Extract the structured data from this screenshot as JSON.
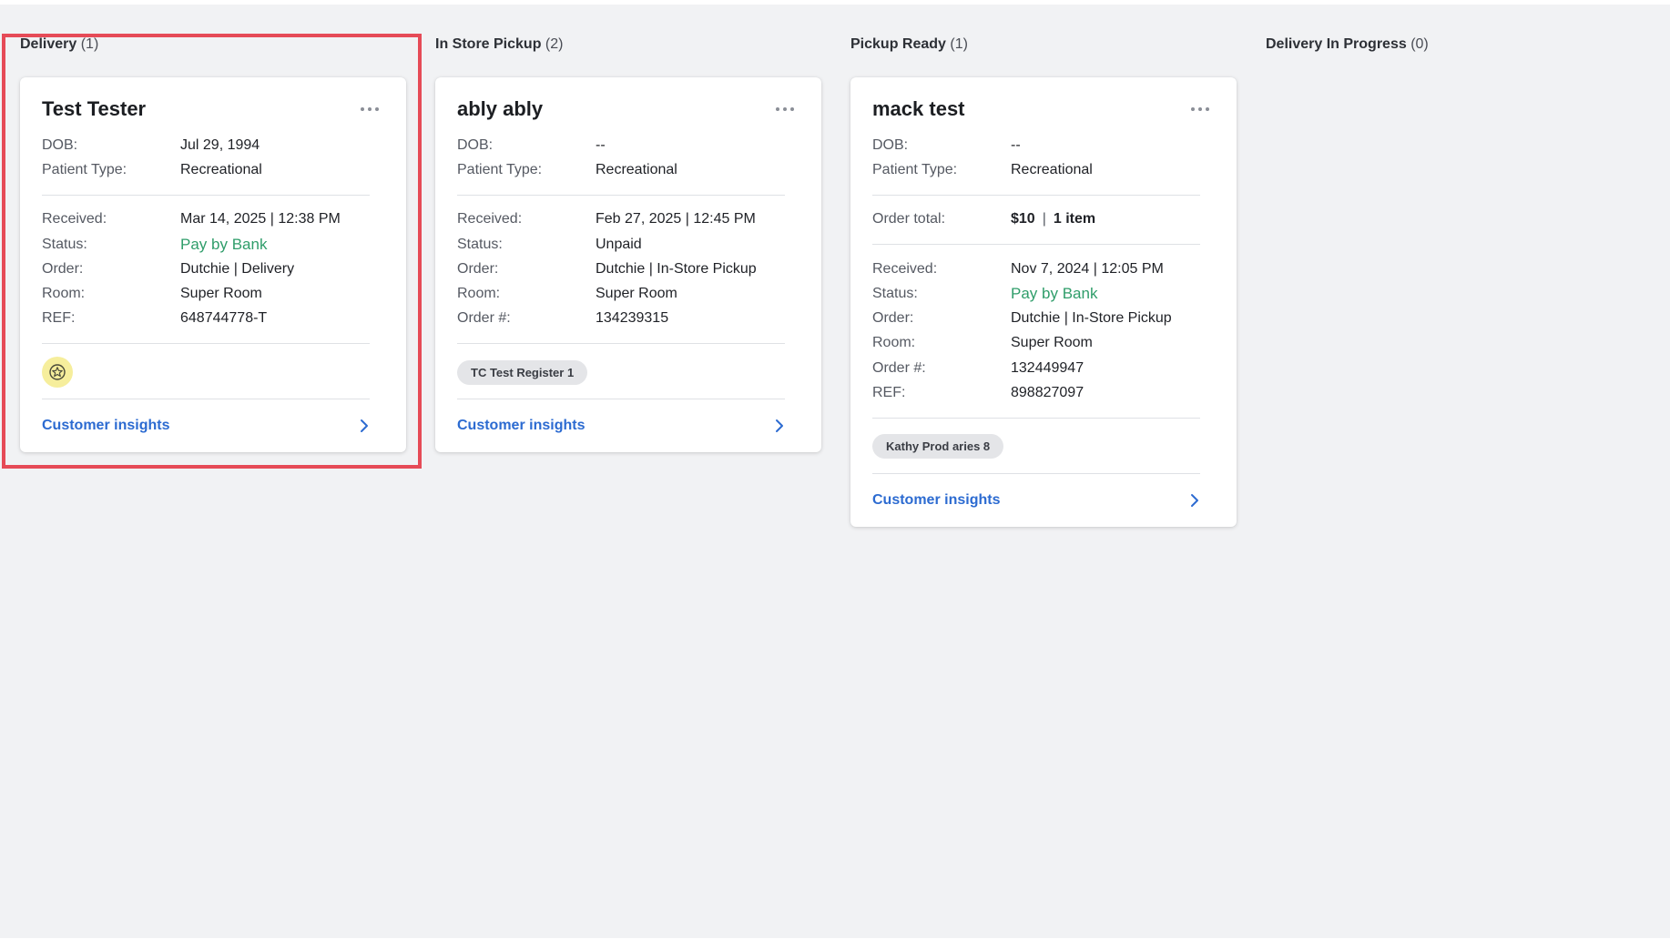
{
  "columns": [
    {
      "title": "Delivery",
      "count": "(1)",
      "cards": [
        {
          "name": "Test Tester",
          "patient": [
            {
              "label": "DOB:",
              "value": "Jul 29, 1994"
            },
            {
              "label": "Patient Type:",
              "value": "Recreational"
            }
          ],
          "details": [
            {
              "label": "Received:",
              "value": "Mar 14, 2025 | 12:38 PM"
            },
            {
              "label": "Status:",
              "value": "Pay by Bank",
              "status_color": "#2f9d6a"
            },
            {
              "label": "Order:",
              "value": "Dutchie | Delivery"
            },
            {
              "label": "Room:",
              "value": "Super Room"
            },
            {
              "label": "REF:",
              "value": "648744778-T"
            }
          ],
          "badge_icon": "star-badge-icon",
          "insights_label": "Customer insights"
        }
      ]
    },
    {
      "title": "In Store Pickup",
      "count": "(2)",
      "cards": [
        {
          "name": "ably ably",
          "patient": [
            {
              "label": "DOB:",
              "value": "--"
            },
            {
              "label": "Patient Type:",
              "value": "Recreational"
            }
          ],
          "details": [
            {
              "label": "Received:",
              "value": "Feb 27, 2025 | 12:45 PM"
            },
            {
              "label": "Status:",
              "value": "Unpaid"
            },
            {
              "label": "Order:",
              "value": "Dutchie | In-Store Pickup"
            },
            {
              "label": "Room:",
              "value": "Super Room"
            },
            {
              "label": "Order #:",
              "value": "134239315"
            }
          ],
          "badge": "TC Test Register 1",
          "insights_label": "Customer insights"
        }
      ]
    },
    {
      "title": "Pickup Ready",
      "count": "(1)",
      "cards": [
        {
          "name": "mack test",
          "patient": [
            {
              "label": "DOB:",
              "value": "--"
            },
            {
              "label": "Patient Type:",
              "value": "Recreational"
            }
          ],
          "order_total": {
            "label": "Order total:",
            "amount": "$10",
            "separator": "|",
            "items": "1 item"
          },
          "details": [
            {
              "label": "Received:",
              "value": "Nov 7, 2024 | 12:05 PM"
            },
            {
              "label": "Status:",
              "value": "Pay by Bank",
              "status_color": "#2f9d6a"
            },
            {
              "label": "Order:",
              "value": "Dutchie | In-Store Pickup"
            },
            {
              "label": "Room:",
              "value": "Super Room"
            },
            {
              "label": "Order #:",
              "value": "132449947"
            },
            {
              "label": "REF:",
              "value": "898827097"
            }
          ],
          "badge": "Kathy Prod aries 8",
          "insights_label": "Customer insights"
        }
      ]
    },
    {
      "title": "Delivery In Progress",
      "count": "(0)",
      "cards": []
    }
  ],
  "colors": {
    "background": "#f1f2f4",
    "link": "#2c6bd1",
    "status_green": "#2f9d6a",
    "highlight": "#e64b57",
    "badge_yellow": "#f6ee9c"
  },
  "highlighted_column": "Delivery"
}
